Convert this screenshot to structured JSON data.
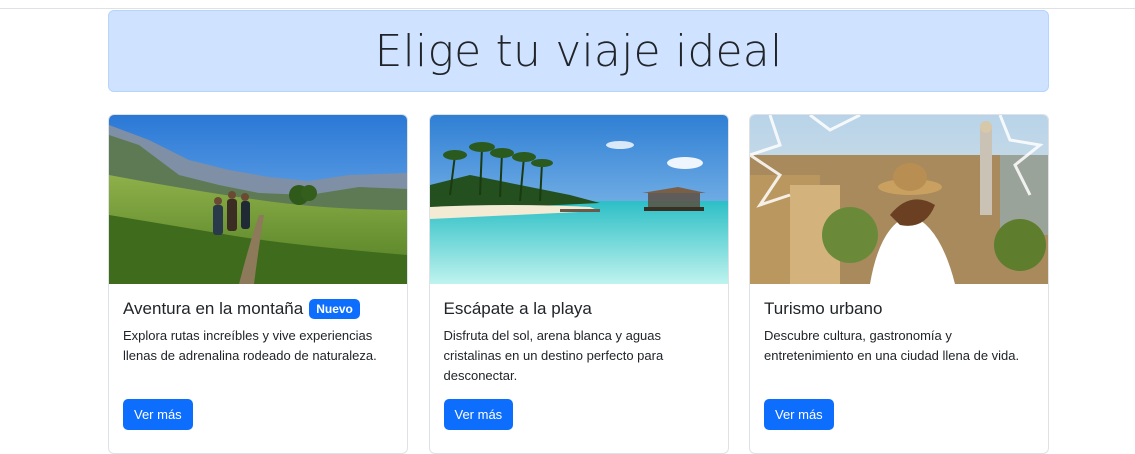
{
  "hero": {
    "title": "Elige tu viaje ideal"
  },
  "cards": [
    {
      "image": "mountain-hikers-photo",
      "title": "Aventura en la montaña",
      "badge": "Nuevo",
      "text": "Explora rutas increíbles y vive experiencias llenas de adrenalina rodeado de naturaleza.",
      "button": "Ver más"
    },
    {
      "image": "tropical-beach-photo",
      "title": "Escápate a la playa",
      "text": "Disfruta del sol, arena blanca y aguas cristalinas en un destino perfecto para desconectar.",
      "button": "Ver más"
    },
    {
      "image": "city-tourist-photo",
      "title": "Turismo urbano",
      "text": "Descubre cultura, gastronomía y entretenimiento en una ciudad llena de vida.",
      "button": "Ver más"
    }
  ],
  "colors": {
    "primary": "#0d6efd",
    "hero_bg": "#cfe2ff"
  }
}
